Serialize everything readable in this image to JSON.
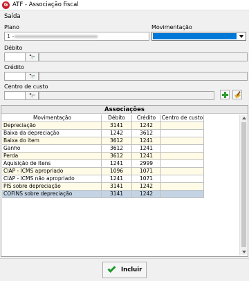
{
  "window": {
    "title": "ATF - Associação fiscal",
    "app_icon": "G"
  },
  "menu": {
    "first": "Saída"
  },
  "form": {
    "plano_label": "Plano",
    "plano_value": "1 -",
    "movimentacao_label": "Movimentação",
    "debito_label": "Débito",
    "credito_label": "Crédito",
    "centro_label": "Centro de custo",
    "selection_color": "#0078d7"
  },
  "associacoes": {
    "title": "Associações",
    "columns": [
      "Movimentação",
      "Débito",
      "Crédito",
      "Centro de custo"
    ],
    "rows": [
      [
        "Depreciação",
        "3141",
        "1242",
        ""
      ],
      [
        "Baixa da depreciação",
        "1242",
        "3612",
        ""
      ],
      [
        "Baixa do item",
        "3612",
        "1241",
        ""
      ],
      [
        "Ganho",
        "3612",
        "1241",
        ""
      ],
      [
        "Perda",
        "3612",
        "1241",
        ""
      ],
      [
        "Aquisição de itens",
        "1241",
        "2999",
        ""
      ],
      [
        "CIAP - ICMS apropriado",
        "1096",
        "1071",
        ""
      ],
      [
        "CIAP - ICMS não apropriado",
        "1241",
        "1071",
        ""
      ],
      [
        "PIS sobre depreciação",
        "3141",
        "1242",
        ""
      ],
      [
        "COFINS sobre depreciação",
        "3141",
        "1242",
        ""
      ]
    ],
    "selected_row": 9
  },
  "footer": {
    "ok_label": "Incluir"
  }
}
